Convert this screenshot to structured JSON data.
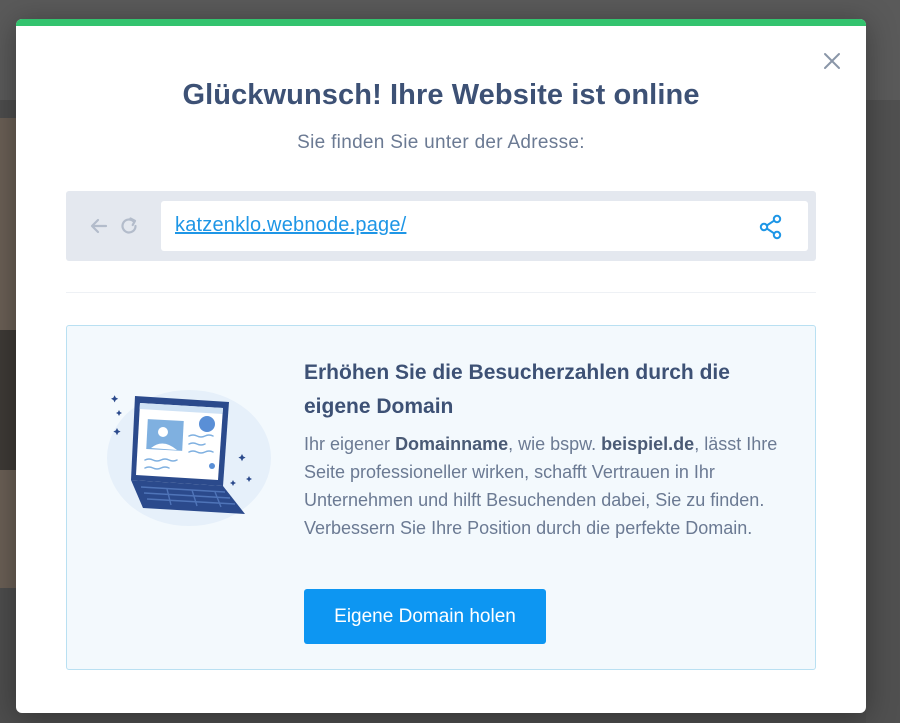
{
  "modal": {
    "title": "Glückwunsch! Ihre Website ist online",
    "subtitle": "Sie finden Sie unter der Adresse:",
    "accent_color": "#33c36e"
  },
  "browser": {
    "url": "katzenklo.webnode.page/",
    "icons": [
      "arrow-left-icon",
      "reload-icon",
      "share-icon"
    ]
  },
  "promo": {
    "title": "Erhöhen Sie die Besucherzahlen durch die eigene Domain",
    "body_part1": "Ihr eigener ",
    "body_bold1": "Domainname",
    "body_part2": ", wie bspw. ",
    "body_bold2": "beispiel.de",
    "body_part3": ", lässt Ihre Seite professioneller wirken, schafft Vertrauen in Ihr Unternehmen und hilft Besuchenden dabei, Sie zu finden. Verbessern Sie Ihre Position durch die perfekte Domain.",
    "button_label": "Eigene Domain holen",
    "button_color": "#0d96f2"
  }
}
